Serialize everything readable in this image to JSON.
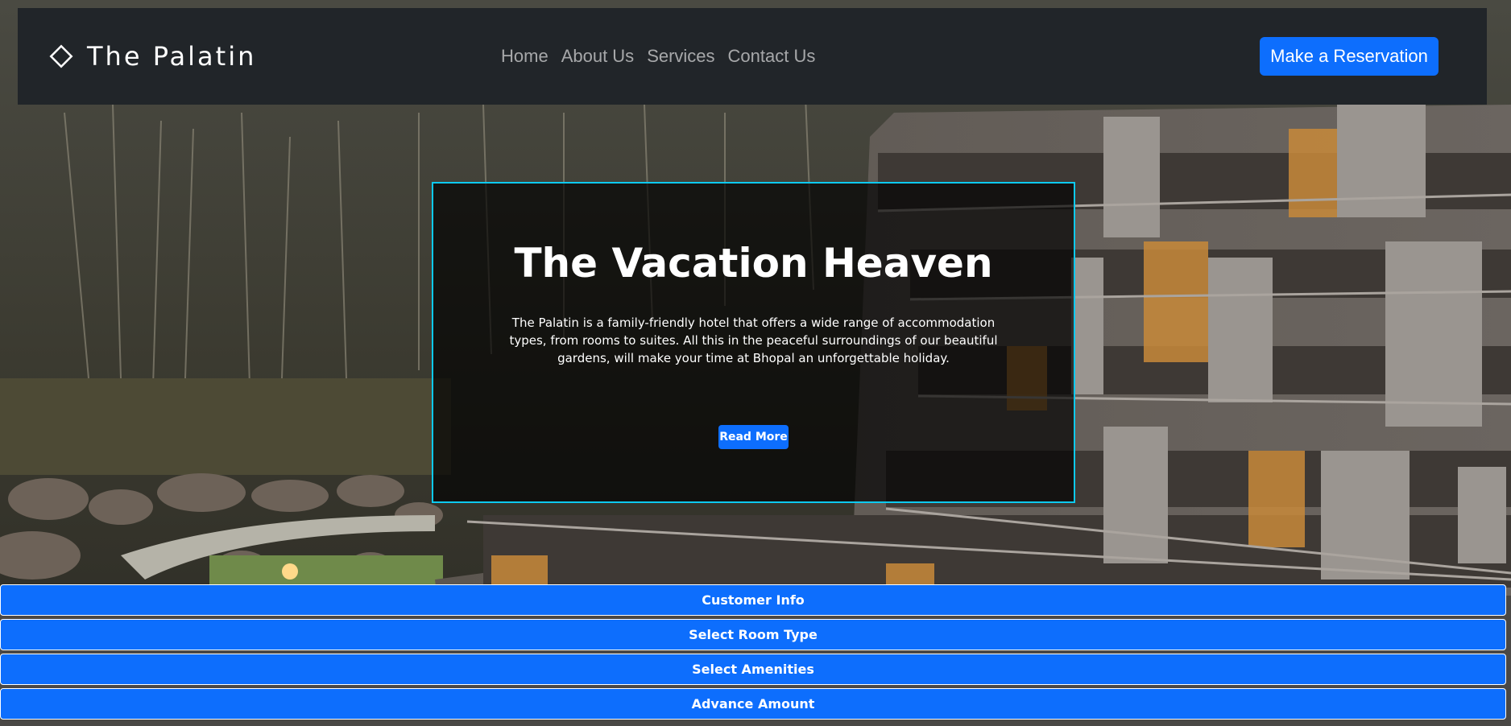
{
  "navbar": {
    "brand": "The Palatin",
    "links": [
      "Home",
      "About Us",
      "Services",
      "Contact Us"
    ],
    "cta": "Make a Reservation"
  },
  "icons": {
    "brand": "diamond-icon"
  },
  "hero": {
    "title": "The Vacation Heaven",
    "description": "The Palatin is a family-friendly hotel that offers a wide range of accommodation types, from rooms to suites. All this in the peaceful surroundings of our beautiful gardens, will make your time at Bhopal an unforgettable holiday.",
    "button": "Read More"
  },
  "sections": [
    "Customer Info",
    "Select Room Type",
    "Select Amenities",
    "Advance Amount"
  ],
  "colors": {
    "navbar_bg": "#212529",
    "primary": "#0d6efd",
    "card_border": "#0dcaf0",
    "nav_link": "rgba(255,255,255,0.6)"
  }
}
